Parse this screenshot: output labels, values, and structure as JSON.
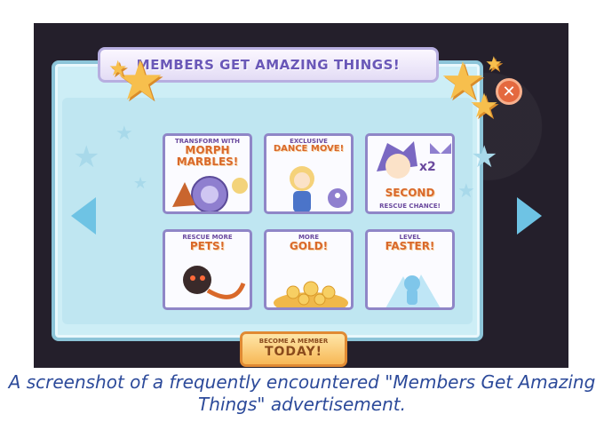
{
  "dialog": {
    "title": "MEMBERS GET AMAZING THINGS!",
    "close_label": "✕"
  },
  "tiles": [
    {
      "line1": "TRANSFORM WITH",
      "line2": "MORPH",
      "line3": "MARBLES!"
    },
    {
      "line1": "EXCLUSIVE",
      "line2": "DANCE MOVE!",
      "line3": ""
    },
    {
      "line1": "x2",
      "line2": "SECOND",
      "line3": "RESCUE CHANCE!"
    },
    {
      "line1": "RESCUE MORE",
      "line2": "PETS!",
      "line3": ""
    },
    {
      "line1": "MORE",
      "line2": "GOLD!",
      "line3": ""
    },
    {
      "line1": "LEVEL",
      "line2": "FASTER!",
      "line3": ""
    }
  ],
  "cta": {
    "line1": "BECOME A MEMBER",
    "line2": "TODAY!"
  },
  "caption": "A screenshot of a frequently encountered \"Members Get Amazing Things\" advertisement.",
  "colors": {
    "panel": "#cdeef6",
    "title": "#6a58b8",
    "accent_orange": "#d9692a",
    "close": "#e4693f",
    "caption": "#2c4a9a"
  }
}
